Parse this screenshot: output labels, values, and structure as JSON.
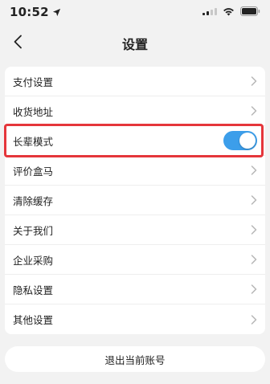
{
  "status_bar": {
    "time": "10:52",
    "icons": [
      "location-arrow-icon",
      "signal-icon",
      "wifi-icon",
      "battery-icon"
    ]
  },
  "header": {
    "title": "设置",
    "back_icon": "chevron-left-icon"
  },
  "settings": {
    "items": [
      {
        "label": "支付设置",
        "type": "link"
      },
      {
        "label": "收货地址",
        "type": "link"
      },
      {
        "label": "长辈模式",
        "type": "toggle",
        "toggle_on": true
      },
      {
        "label": "评价盒马",
        "type": "link"
      },
      {
        "label": "清除缓存",
        "type": "link"
      },
      {
        "label": "关于我们",
        "type": "link"
      },
      {
        "label": "企业采购",
        "type": "link"
      },
      {
        "label": "隐私设置",
        "type": "link"
      },
      {
        "label": "其他设置",
        "type": "link"
      }
    ]
  },
  "logout": {
    "label": "退出当前账号"
  },
  "colors": {
    "background": "#f2f2f2",
    "card": "#ffffff",
    "toggle_on": "#3c9eea",
    "highlight": "#e5363b",
    "chevron": "#b7b7b7"
  }
}
